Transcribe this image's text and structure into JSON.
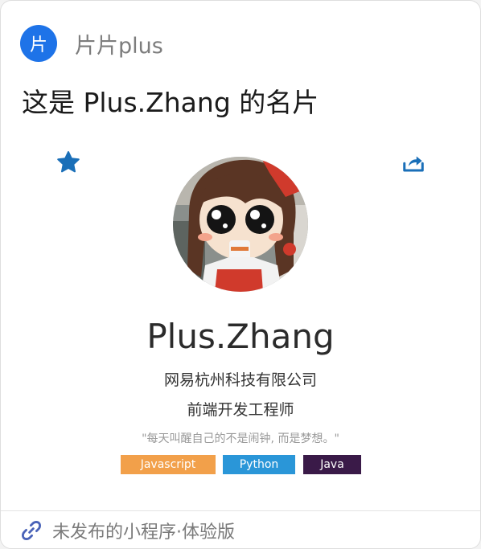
{
  "header": {
    "app_icon_char": "片",
    "app_name": "片片plus",
    "accent_color": "#1e73e8"
  },
  "title": "这是 Plus.Zhang 的名片",
  "actions": {
    "favorite_icon": "star-icon",
    "share_icon": "share-icon",
    "icon_color": "#1a6fb8"
  },
  "profile": {
    "name": "Plus.Zhang",
    "company": "网易杭州科技有限公司",
    "role": "前端开发工程师",
    "motto": "\"每天叫醒自己的不是闹钟, 而是梦想。\""
  },
  "tags": [
    {
      "label": "Javascript",
      "color": "#f2a04a"
    },
    {
      "label": "Python",
      "color": "#2a96d8"
    },
    {
      "label": "Java",
      "color": "#3a1a48"
    }
  ],
  "footer": {
    "text": "未发布的小程序·体验版",
    "icon": "link-icon"
  }
}
